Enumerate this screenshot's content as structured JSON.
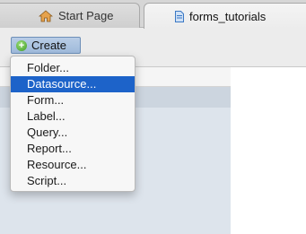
{
  "tabs": [
    {
      "label": "Start Page",
      "icon": "home-icon",
      "active": false
    },
    {
      "label": "forms_tutorials",
      "icon": "document-icon",
      "active": true
    }
  ],
  "toolbar": {
    "create_label": "Create",
    "create_icon": "plus-circle-icon"
  },
  "create_menu": {
    "items": [
      {
        "label": "Folder..."
      },
      {
        "label": "Datasource...",
        "selected": true
      },
      {
        "label": "Form..."
      },
      {
        "label": "Label..."
      },
      {
        "label": "Query..."
      },
      {
        "label": "Report..."
      },
      {
        "label": "Resource..."
      },
      {
        "label": "Script..."
      }
    ]
  },
  "colors": {
    "selection": "#1d63c9",
    "create_button": "#b9cde6",
    "list_background": "#dde4ec"
  }
}
